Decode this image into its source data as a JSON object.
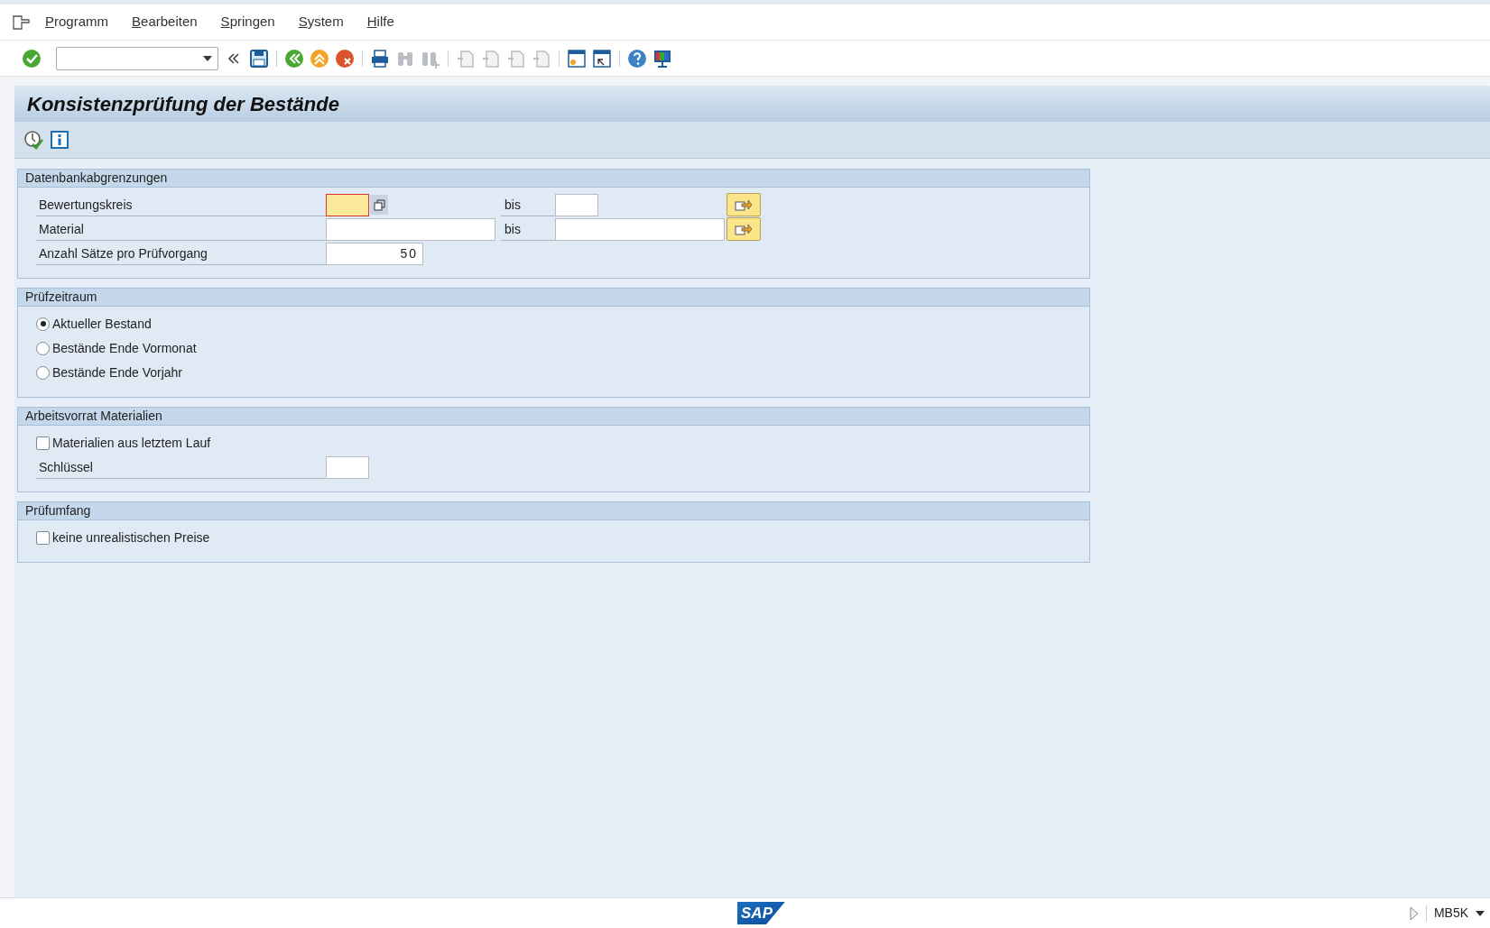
{
  "menu_bar": {
    "items": [
      {
        "label": "Programm"
      },
      {
        "label": "Bearbeiten"
      },
      {
        "label": "Springen"
      },
      {
        "label": "System"
      },
      {
        "label": "Hilfe"
      }
    ]
  },
  "title": "Konsistenzprüfung der Bestände",
  "groups": [
    {
      "title": "Datenbankabgrenzungen",
      "rows": [
        {
          "kind": "keyrange",
          "label": "Bewertungskreis",
          "from": {
            "focused": true
          },
          "bis": "bis"
        },
        {
          "kind": "range",
          "label": "Material",
          "bis": "bis"
        },
        {
          "kind": "number",
          "label": "Anzahl Sätze pro Prüfvorgang",
          "field": {
            "value": "50"
          }
        }
      ]
    },
    {
      "title": "Prüfzeitraum",
      "rows": [
        {
          "kind": "radio",
          "label": "Aktueller Bestand",
          "selected": true
        },
        {
          "kind": "radio",
          "label": "Bestände Ende Vormonat",
          "selected": false
        },
        {
          "kind": "radio",
          "label": "Bestände Ende Vorjahr",
          "selected": false
        }
      ]
    },
    {
      "title": "Arbeitsvorrat Materialien",
      "rows": [
        {
          "kind": "checkbox",
          "label": "Materialien aus letztem Lauf",
          "checked": false
        },
        {
          "kind": "key",
          "label": "Schlüssel"
        }
      ]
    },
    {
      "title": "Prüfumfang",
      "rows": [
        {
          "kind": "checkbox",
          "label": "keine unrealistischen Preise",
          "checked": false
        }
      ]
    }
  ],
  "status_bar": {
    "logo": "SAP",
    "transaction": "MB5K"
  }
}
